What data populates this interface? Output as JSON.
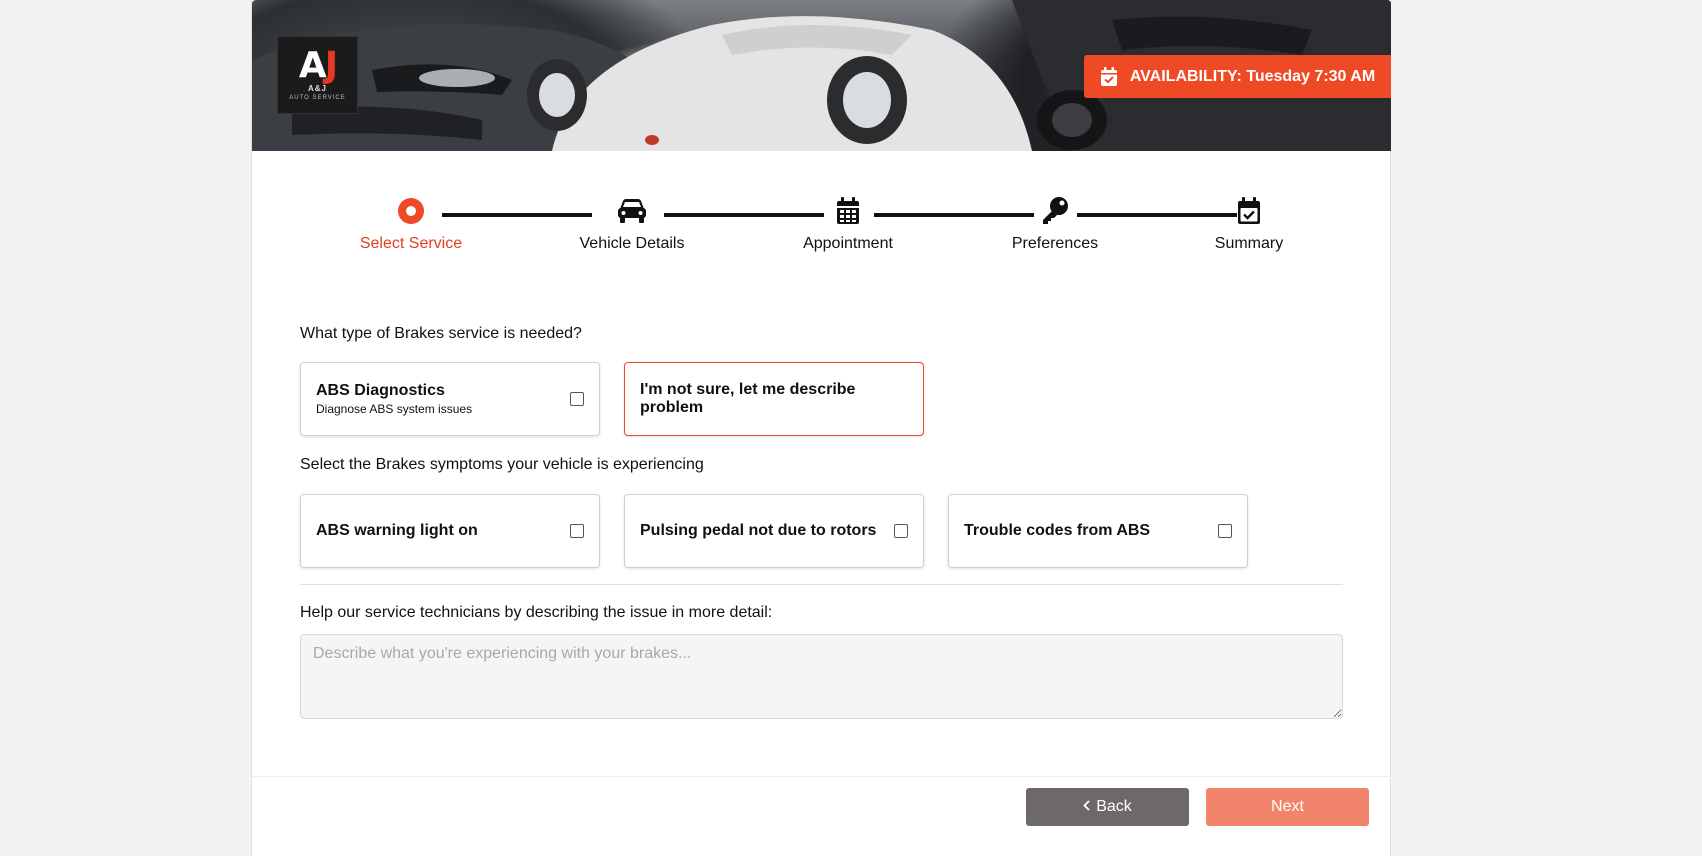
{
  "header": {
    "logo": {
      "mark_left": "A",
      "mark_right": "J",
      "name": "A&J",
      "tagline": "AUTO SERVICE"
    },
    "availability": {
      "icon": "calendar-check-icon",
      "text": "AVAILABILITY: Tuesday 7:30 AM"
    }
  },
  "stepper": {
    "steps": [
      {
        "label": "Select Service",
        "icon": "radio-dot-icon",
        "active": true
      },
      {
        "label": "Vehicle Details",
        "icon": "car-icon",
        "active": false
      },
      {
        "label": "Appointment",
        "icon": "calendar-icon",
        "active": false
      },
      {
        "label": "Preferences",
        "icon": "key-icon",
        "active": false
      },
      {
        "label": "Summary",
        "icon": "calendar-check-icon",
        "active": false
      }
    ]
  },
  "service": {
    "question": "What type of Brakes service is needed?",
    "options": [
      {
        "title": "ABS Diagnostics",
        "subtitle": "Diagnose ABS system issues",
        "checked": false
      },
      {
        "title": "I'm not sure, let me describe problem",
        "selected": true
      }
    ]
  },
  "symptoms": {
    "question": "Select the Brakes symptoms your vehicle is experiencing",
    "options": [
      {
        "title": "ABS warning light on",
        "checked": false
      },
      {
        "title": "Pulsing pedal not due to rotors",
        "checked": false
      },
      {
        "title": "Trouble codes from ABS",
        "checked": false
      }
    ]
  },
  "details": {
    "label": "Help our service technicians by describing the issue in more detail:",
    "value": "",
    "placeholder": "Describe what you're experiencing with your brakes..."
  },
  "nav": {
    "back_label": "Back",
    "back_icon": "chevron-left-icon",
    "next_label": "Next"
  },
  "colors": {
    "accent": "#ee4a25",
    "active_step": "#e53c1e",
    "back_button": "#6e6969",
    "next_button": "#f3846c"
  }
}
